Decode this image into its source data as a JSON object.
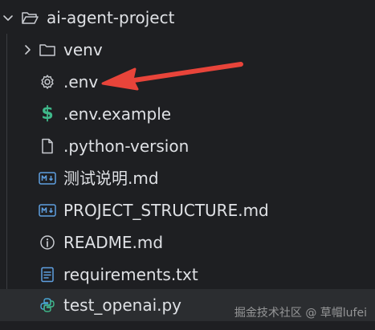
{
  "explorer": {
    "root": {
      "label": "ai-agent-project",
      "icon": "folder-open-icon",
      "expanded": true
    },
    "items": [
      {
        "label": "venv",
        "icon": "folder-icon",
        "kind": "folder",
        "expandable": true
      },
      {
        "label": ".env",
        "icon": "gear-icon",
        "kind": "file"
      },
      {
        "label": ".env.example",
        "icon": "dollar-icon",
        "kind": "file"
      },
      {
        "label": ".python-version",
        "icon": "file-icon",
        "kind": "file"
      },
      {
        "label": "测试说明.md",
        "icon": "markdown-icon",
        "kind": "file"
      },
      {
        "label": "PROJECT_STRUCTURE.md",
        "icon": "markdown-icon",
        "kind": "file"
      },
      {
        "label": "README.md",
        "icon": "info-icon",
        "kind": "file"
      },
      {
        "label": "requirements.txt",
        "icon": "text-file-icon",
        "kind": "file"
      },
      {
        "label": "test_openai.py",
        "icon": "python-icon",
        "kind": "file",
        "selected": true
      }
    ]
  },
  "annotation": {
    "type": "arrow",
    "color": "#e8443a",
    "points_to": ".env"
  },
  "watermark": {
    "text": "掘金技术社区 @ 草帽lufei"
  },
  "colors": {
    "background": "#1e1f22",
    "selected_row": "#2b2d30",
    "text": "#dfe1e5",
    "icon": "#c9ccd1",
    "markdown_icon": "#5f9fe0",
    "dollar_icon": "#3fb88a",
    "python_icon": "#4aa8d8"
  }
}
